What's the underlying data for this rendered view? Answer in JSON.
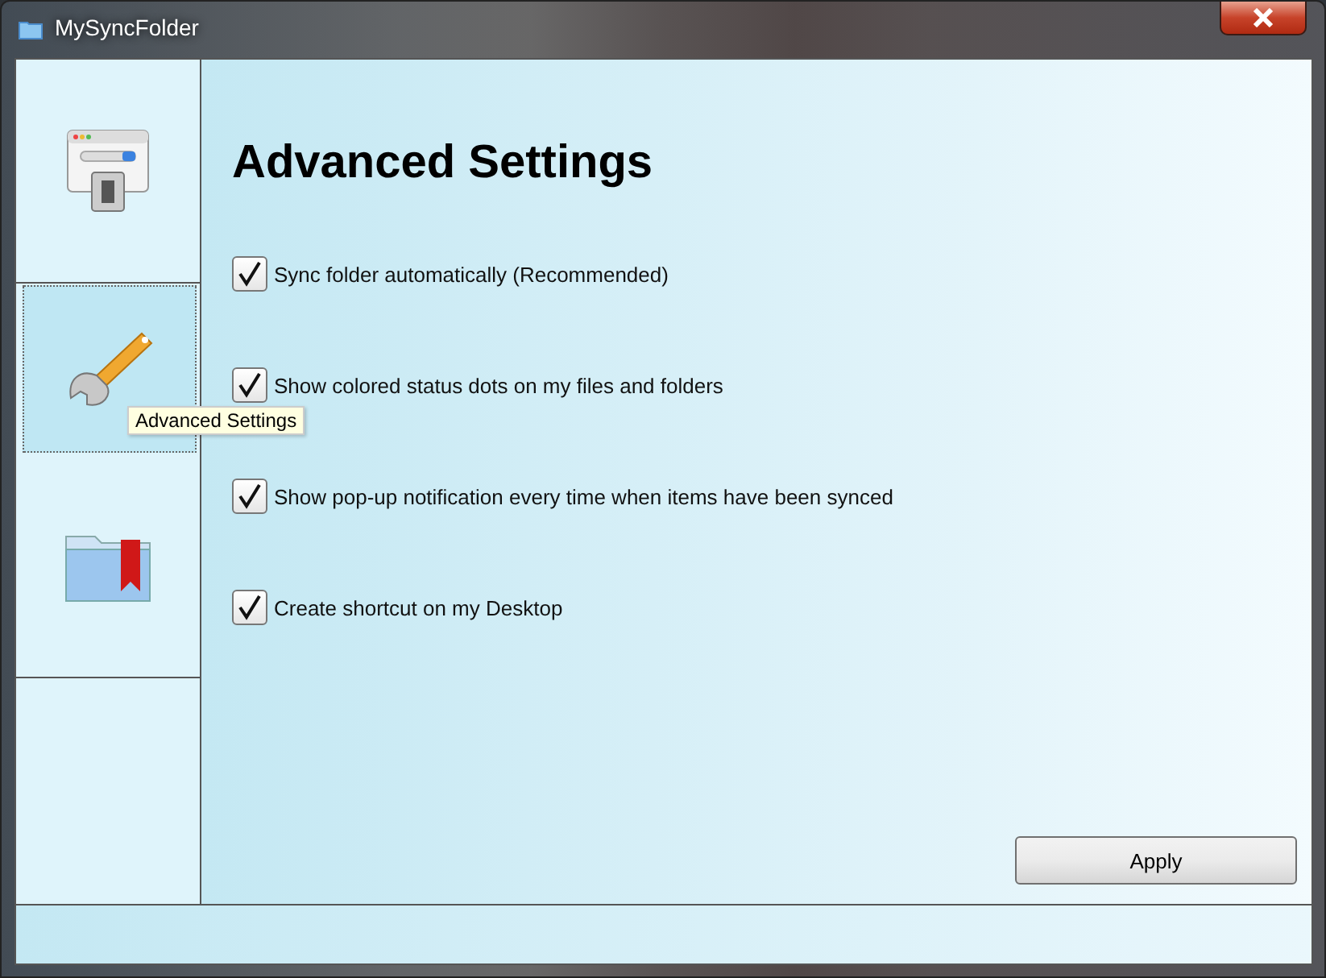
{
  "window": {
    "title": "MySyncFolder"
  },
  "sidebar": {
    "tabs": [
      {
        "kind": "window",
        "selected": false
      },
      {
        "kind": "wrench",
        "selected": true,
        "tooltip": "Advanced Settings"
      },
      {
        "kind": "folder",
        "selected": false
      }
    ]
  },
  "heading": "Advanced Settings",
  "options": [
    {
      "label": "Sync folder automatically (Recommended)",
      "checked": true
    },
    {
      "label": "Show colored status dots on my files and folders",
      "checked": true
    },
    {
      "label": "Show pop-up notification every time when items have been synced",
      "checked": true
    },
    {
      "label": "Create shortcut on my Desktop",
      "checked": true
    }
  ],
  "buttons": [
    {
      "label": "Apply"
    }
  ]
}
